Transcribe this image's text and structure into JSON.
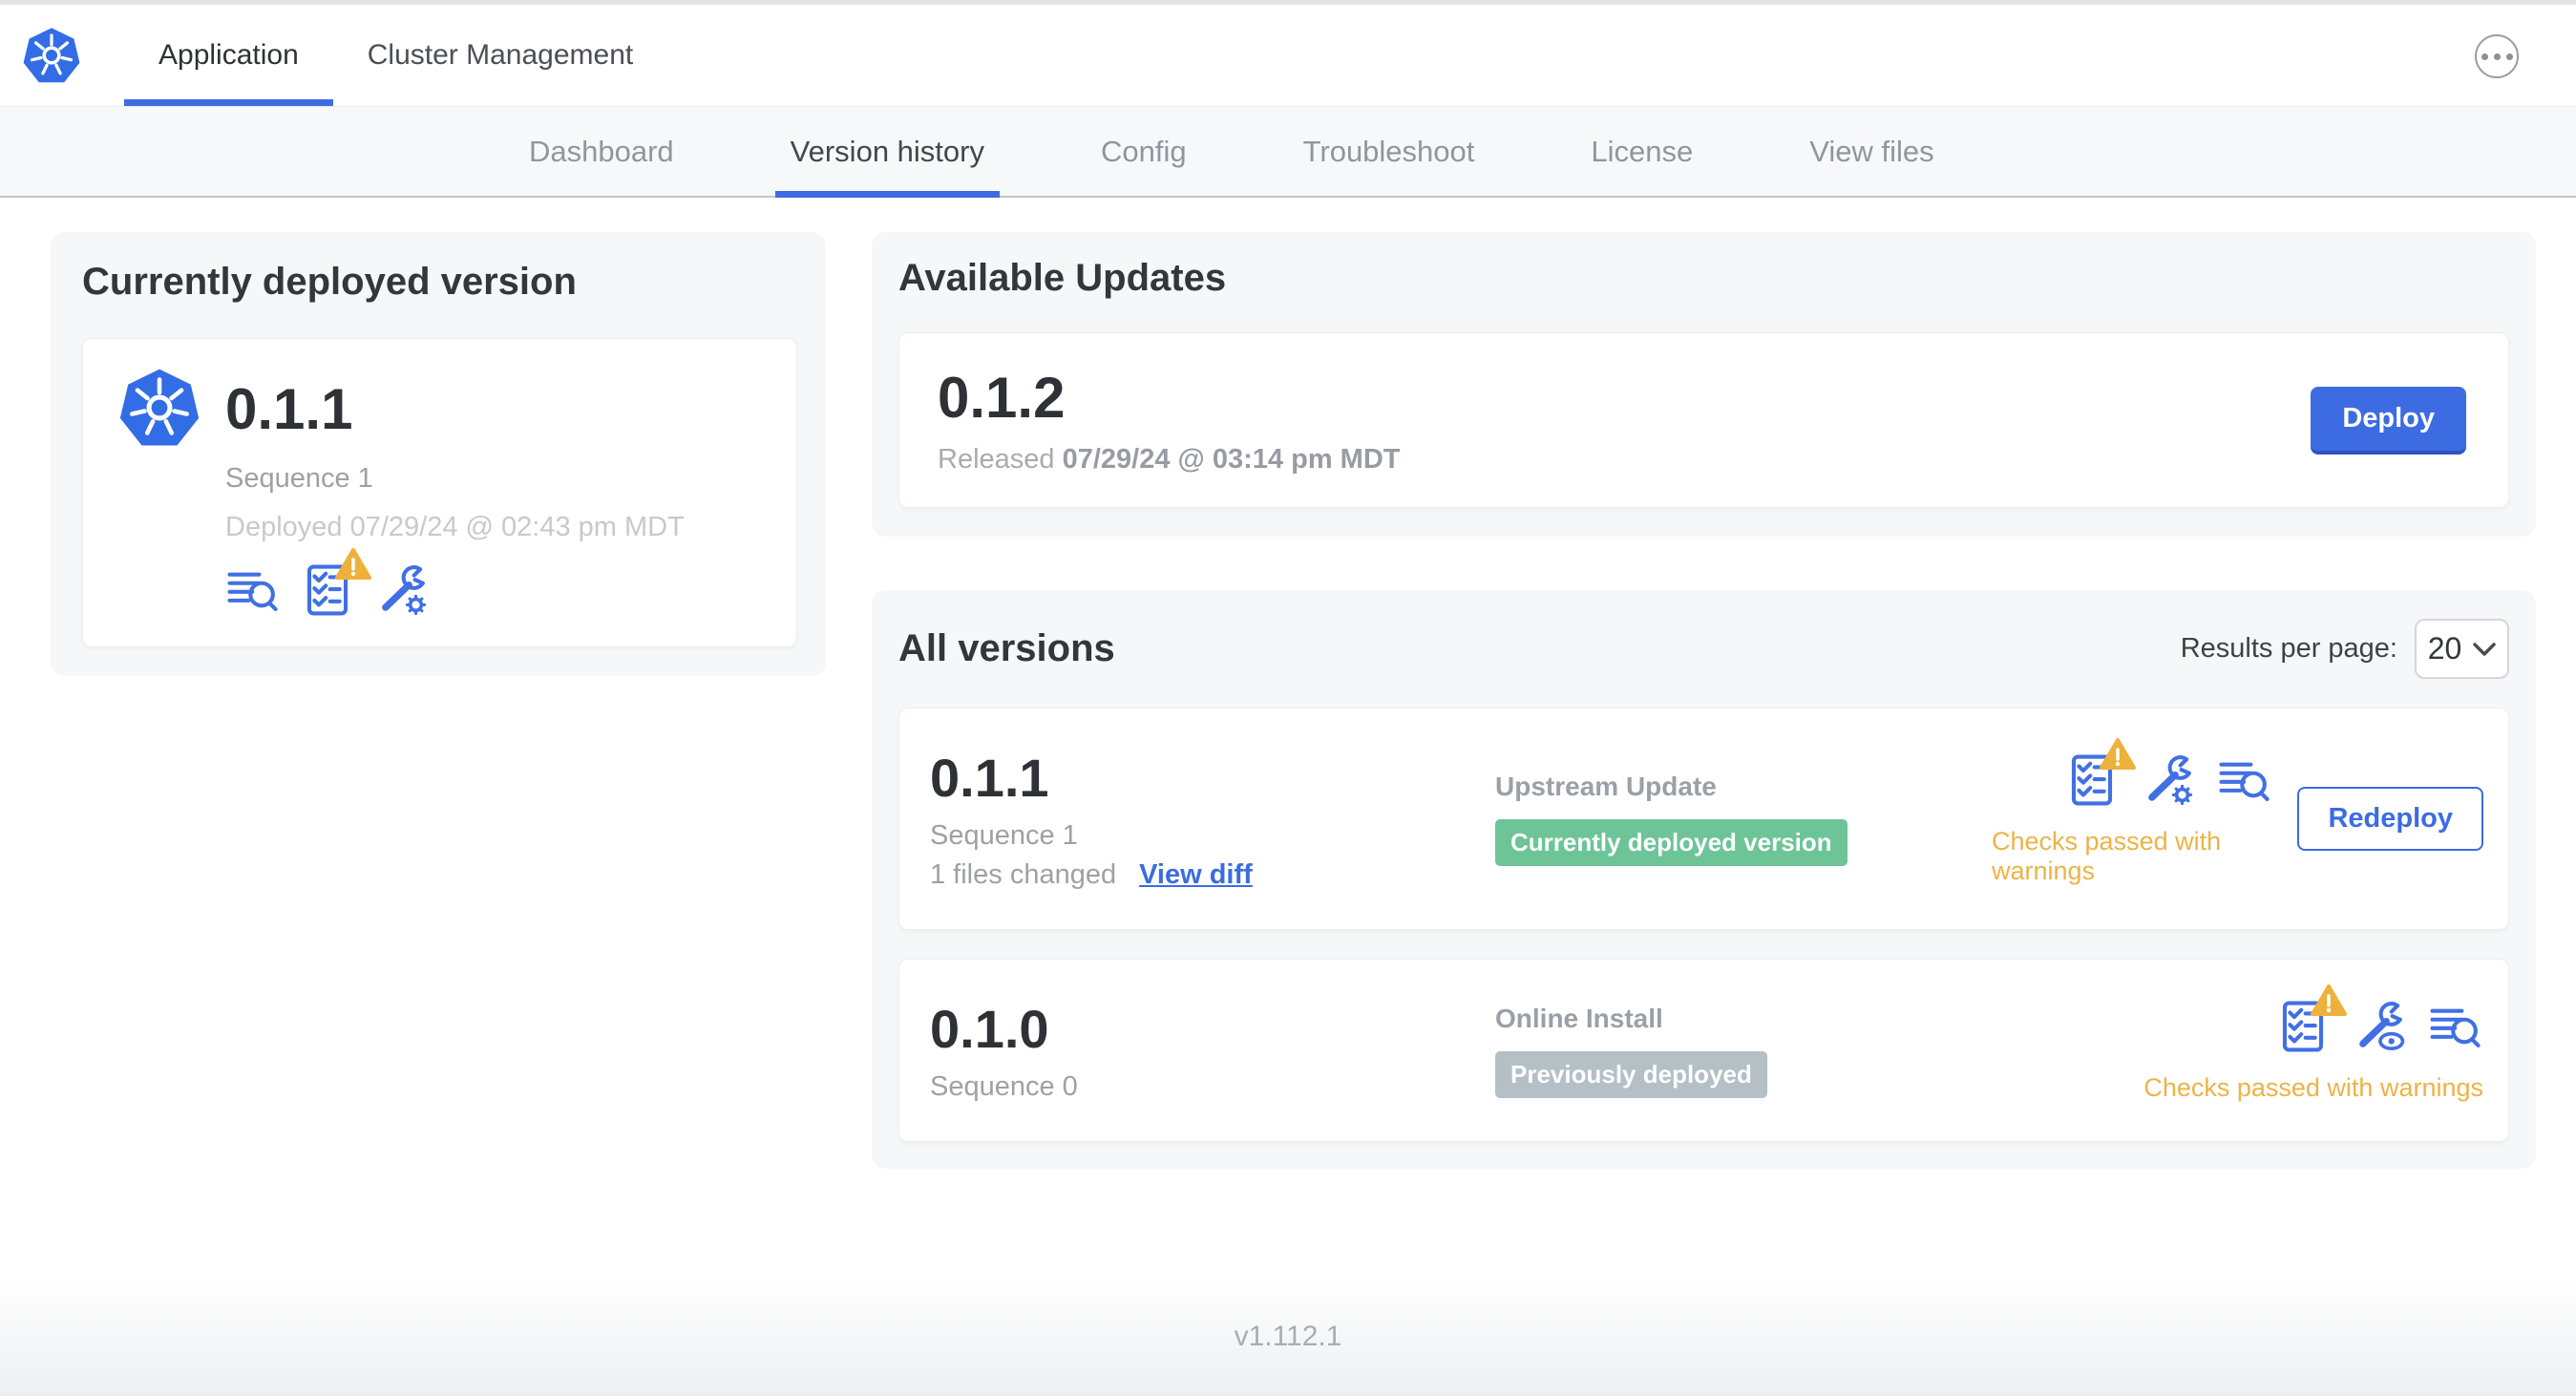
{
  "header": {
    "tabs": [
      {
        "label": "Application"
      },
      {
        "label": "Cluster Management"
      }
    ],
    "active_tab": "Application"
  },
  "subnav": {
    "tabs": [
      "Dashboard",
      "Version history",
      "Config",
      "Troubleshoot",
      "License",
      "View files"
    ],
    "active_tab": "Version history"
  },
  "current_version": {
    "heading": "Currently deployed version",
    "version": "0.1.1",
    "sequence": "Sequence 1",
    "deployed": "Deployed 07/29/24 @ 02:43 pm MDT",
    "icons": [
      "deploy-logs",
      "preflight-checks-warning",
      "edit-config"
    ]
  },
  "available_updates": {
    "heading": "Available Updates",
    "version": "0.1.2",
    "released_label": "Released",
    "released_date": "07/29/24 @ 03:14 pm MDT",
    "deploy_button": "Deploy"
  },
  "all_versions": {
    "heading": "All versions",
    "results_per_page_label": "Results per page:",
    "results_per_page_value": "20",
    "rows": [
      {
        "version": "0.1.1",
        "sequence": "Sequence 1",
        "files_changed": "1 files changed",
        "view_diff": "View diff",
        "source": "Upstream Update",
        "badge": "Currently deployed version",
        "badge_color": "#6cc497",
        "status": "Checks passed with warnings",
        "action": "Redeploy",
        "icons": [
          "preflight-checks-warning",
          "edit-config",
          "deploy-logs"
        ]
      },
      {
        "version": "0.1.0",
        "sequence": "Sequence 0",
        "source": "Online Install",
        "badge": "Previously deployed",
        "badge_color": "#b4bfc6",
        "status": "Checks passed with warnings",
        "icons": [
          "preflight-checks-warning",
          "view-config",
          "deploy-logs"
        ]
      }
    ]
  },
  "footer": {
    "app_version": "v1.112.1"
  },
  "colors": {
    "accent_blue": "#3b6ce0",
    "icon_blue": "#4170e4",
    "warning_amber": "#ecb347",
    "badge_green": "#6cc497",
    "badge_gray": "#b4bfc6",
    "subnav_bg": "#f7f8fa",
    "card_bg": "#f6f7f9"
  }
}
